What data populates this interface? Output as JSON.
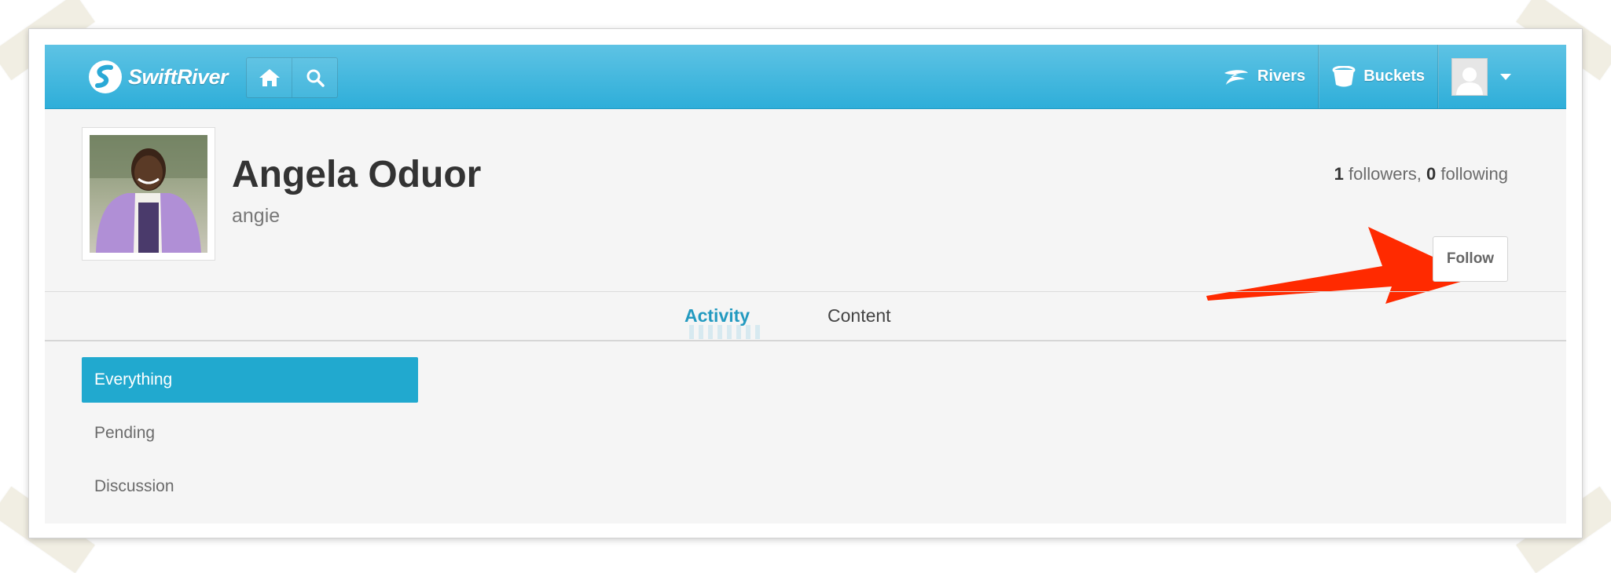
{
  "header": {
    "logo_text": "SwiftRiver",
    "nav_links": [
      {
        "label": "Rivers",
        "icon": "river-icon"
      },
      {
        "label": "Buckets",
        "icon": "bucket-icon"
      }
    ],
    "home_icon": "home-icon",
    "search_icon": "search-icon",
    "avatar_menu_icon": "chevron-down-icon"
  },
  "profile": {
    "name": "Angela Oduor",
    "username": "angie",
    "followers_count": "1",
    "followers_label": "followers,",
    "following_count": "0",
    "following_label": "following",
    "follow_button": "Follow"
  },
  "tabs": [
    {
      "label": "Activity",
      "active": true
    },
    {
      "label": "Content",
      "active": false
    }
  ],
  "filters": [
    {
      "label": "Everything",
      "active": true
    },
    {
      "label": "Pending",
      "active": false
    },
    {
      "label": "Discussion",
      "active": false
    }
  ],
  "colors": {
    "header_blue": "#3bb6de",
    "active_tab": "#239ac0",
    "active_filter": "#21a9cf",
    "annotation_arrow": "#ff2a00"
  }
}
